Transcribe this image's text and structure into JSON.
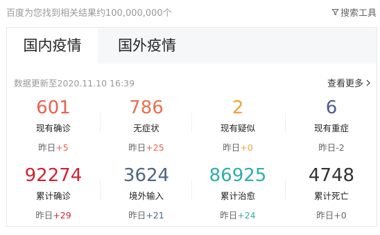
{
  "header": {
    "result_count": "百度为您找到相关结果约100,000,000个",
    "search_tools": "搜索工具"
  },
  "tabs": [
    {
      "label": "国内疫情"
    },
    {
      "label": "国外疫情"
    }
  ],
  "update_time": "数据更新至2020.11.10 16:39",
  "view_more": "查看更多",
  "stats": [
    {
      "value": "601",
      "label": "现有确诊",
      "change_prefix": "昨日",
      "change": "+5",
      "color": "#e8604f",
      "change_color": "#e8604f"
    },
    {
      "value": "786",
      "label": "无症状",
      "change_prefix": "昨日",
      "change": "+25",
      "color": "#e8704f",
      "change_color": "#e8604f"
    },
    {
      "value": "2",
      "label": "现有疑似",
      "change_prefix": "昨日",
      "change": "+0",
      "color": "#f1a13a",
      "change_color": "#f1a13a"
    },
    {
      "value": "6",
      "label": "现有重症",
      "change_prefix": "昨日",
      "change": "-2",
      "color": "#4f5b8f",
      "change_color": "#666666"
    },
    {
      "value": "92274",
      "label": "累计确诊",
      "change_prefix": "昨日",
      "change": "+29",
      "color": "#cc2530",
      "change_color": "#cc2530"
    },
    {
      "value": "3624",
      "label": "境外输入",
      "change_prefix": "昨日",
      "change": "+21",
      "color": "#4c6584",
      "change_color": "#4c6584"
    },
    {
      "value": "86925",
      "label": "累计治愈",
      "change_prefix": "昨日",
      "change": "+24",
      "color": "#2eadaa",
      "change_color": "#2eadaa"
    },
    {
      "value": "4748",
      "label": "累计死亡",
      "change_prefix": "昨日",
      "change": "+0",
      "color": "#333333",
      "change_color": "#666666"
    }
  ]
}
